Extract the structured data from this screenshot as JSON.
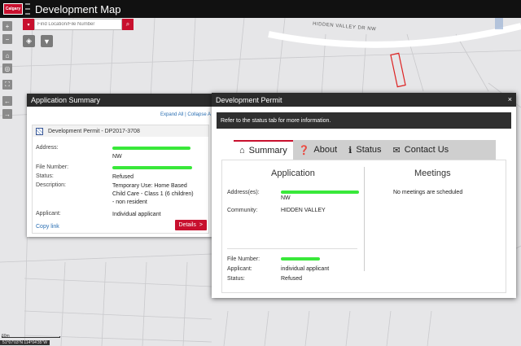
{
  "header": {
    "logo_text": "Calgary",
    "title": "Development Map"
  },
  "search": {
    "placeholder": "Find Location/File Number"
  },
  "map": {
    "street_label": "HIDDEN VALLEY DR NW",
    "scale_label": "60m",
    "coordinates": "51°07'03\"N 114°04'35\"W"
  },
  "summary_panel": {
    "title": "Application Summary",
    "expand_all": "Expand All",
    "separator": "|",
    "collapse_all": "Collapse A",
    "card_title": "Development Permit - DP2017-3708",
    "address_label": "Address:",
    "address_suffix": "NW",
    "file_number_label": "File Number:",
    "status_label": "Status:",
    "status_value": "Refused",
    "description_label": "Description:",
    "description_value": "Temporary Use: Home Based Child Care - Class 1 (6 children) - non resident",
    "applicant_label": "Applicant:",
    "applicant_value": "Individual applicant",
    "copy_link": "Copy link",
    "details_button": "Details",
    "details_chevron": ">"
  },
  "modal": {
    "title": "Development Permit",
    "close": "×",
    "notice": "Refer to the status tab for more information.",
    "tabs": [
      {
        "label": "Summary",
        "icon": "home-icon"
      },
      {
        "label": "About",
        "icon": "question-icon"
      },
      {
        "label": "Status",
        "icon": "info-icon"
      },
      {
        "label": "Contact Us",
        "icon": "envelope-icon"
      }
    ],
    "application": {
      "title": "Application",
      "address_label": "Address(es):",
      "address_suffix": "NW",
      "community_label": "Community:",
      "community_value": "HIDDEN VALLEY",
      "file_number_label": "File Number:",
      "applicant_label": "Applicant:",
      "applicant_value": "individual applicant",
      "status_label": "Status:",
      "status_value": "Refused"
    },
    "meetings": {
      "title": "Meetings",
      "empty_text": "No meetings are scheduled"
    }
  },
  "colors": {
    "brand_red": "#c8102e",
    "header_bg": "#111111",
    "redaction_green": "#39e83a"
  }
}
